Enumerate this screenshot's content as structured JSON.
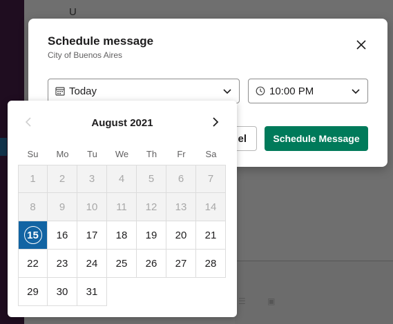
{
  "background": {
    "letter": "U"
  },
  "dialog": {
    "title": "Schedule message",
    "subtitle": "City of Buenos Aires",
    "date_value": "Today",
    "time_value": "10:00 PM",
    "cancel_label": "Cancel",
    "cancel_visible": "el",
    "schedule_label": "Schedule Message",
    "accent_color": "#007a5a"
  },
  "calendar": {
    "month_label": "August 2021",
    "weekdays": [
      "Su",
      "Mo",
      "Tu",
      "We",
      "Th",
      "Fr",
      "Sa"
    ],
    "rows": [
      [
        "1",
        "2",
        "3",
        "4",
        "5",
        "6",
        "7"
      ],
      [
        "8",
        "9",
        "10",
        "11",
        "12",
        "13",
        "14"
      ],
      [
        "15",
        "16",
        "17",
        "18",
        "19",
        "20",
        "21"
      ],
      [
        "22",
        "23",
        "24",
        "25",
        "26",
        "27",
        "28"
      ],
      [
        "29",
        "30",
        "31"
      ]
    ],
    "disabled_days": [
      "1",
      "2",
      "3",
      "4",
      "5",
      "6",
      "7",
      "8",
      "9",
      "10",
      "11",
      "12",
      "13",
      "14"
    ],
    "selected_day": "15",
    "selected_color": "#1264a3"
  }
}
